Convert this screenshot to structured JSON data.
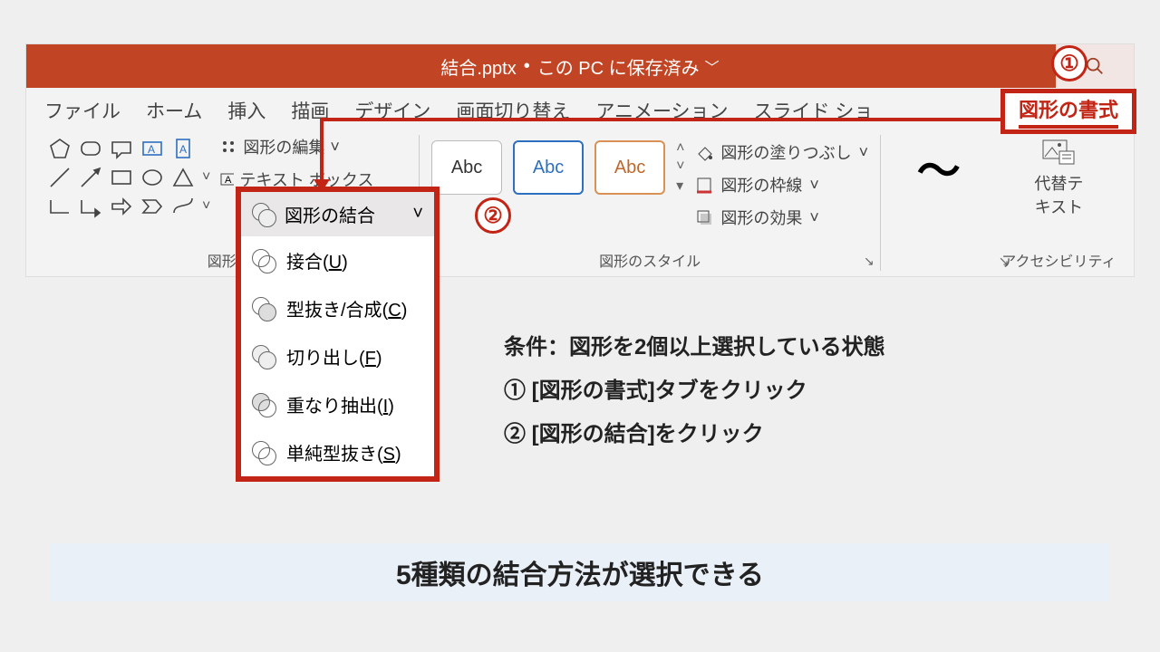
{
  "title": {
    "filename": "結合.pptx",
    "status": "この PC に保存済み"
  },
  "tabs": {
    "file": "ファイル",
    "home": "ホーム",
    "insert": "挿入",
    "draw": "描画",
    "design": "デザイン",
    "transition": "画面切り替え",
    "animation": "アニメーション",
    "slideshow": "スライド ショ",
    "shape_format": "図形の書式"
  },
  "ribbon": {
    "shapes_group_label": "図形の",
    "edit_shape": "図形の編集",
    "text_box": "テキスト ボックス",
    "styles_group_label": "図形のスタイル",
    "accessibility_label": "アクセシビリティ",
    "abc": "Abc",
    "fill": "図形の塗りつぶし",
    "outline": "図形の枠線",
    "effects": "図形の効果",
    "alt_text": "代替テ\nキスト",
    "tilde": "～"
  },
  "menu": {
    "head": "図形の結合",
    "items": [
      {
        "label": "接合",
        "shortcut": "U"
      },
      {
        "label": "型抜き/合成",
        "shortcut": "C"
      },
      {
        "label": "切り出し",
        "shortcut": "F"
      },
      {
        "label": "重なり抽出",
        "shortcut": "I"
      },
      {
        "label": "単純型抜き",
        "shortcut": "S"
      }
    ]
  },
  "callouts": {
    "one": "①",
    "two": "②",
    "line0": "条件：図形を2個以上選択している状態",
    "line1": "① [図形の書式]タブをクリック",
    "line2": "② [図形の結合]をクリック"
  },
  "bottom": "5種類の結合方法が選択できる"
}
